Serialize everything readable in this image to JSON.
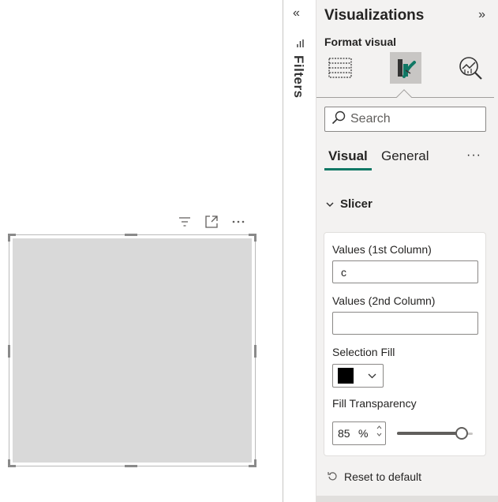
{
  "filters": {
    "label": "Filters",
    "collapse_icon": "«"
  },
  "visualizations": {
    "title": "Visualizations",
    "expand_icon": "»",
    "format_label": "Format visual",
    "mode_icons": [
      "fields-icon",
      "format-icon",
      "analytics-icon"
    ],
    "search_placeholder": "Search",
    "tabs": [
      {
        "label": "Visual",
        "active": true
      },
      {
        "label": "General",
        "active": false
      }
    ],
    "more_label": "···",
    "section_title": "Slicer",
    "values_1st_label": "Values (1st Column)",
    "values_1st_value": "c",
    "values_2nd_label": "Values (2nd Column)",
    "values_2nd_value": "",
    "selection_fill_label": "Selection Fill",
    "selection_fill_color": "#000000",
    "fill_transparency_label": "Fill Transparency",
    "fill_transparency_value": "85",
    "fill_transparency_unit": "%",
    "fill_transparency_fraction": 0.85,
    "reset_label": "Reset to default"
  },
  "colors": {
    "accent": "#117865",
    "pane_bg": "#f3f2f1",
    "visual_fill": "#d9d9d9"
  }
}
